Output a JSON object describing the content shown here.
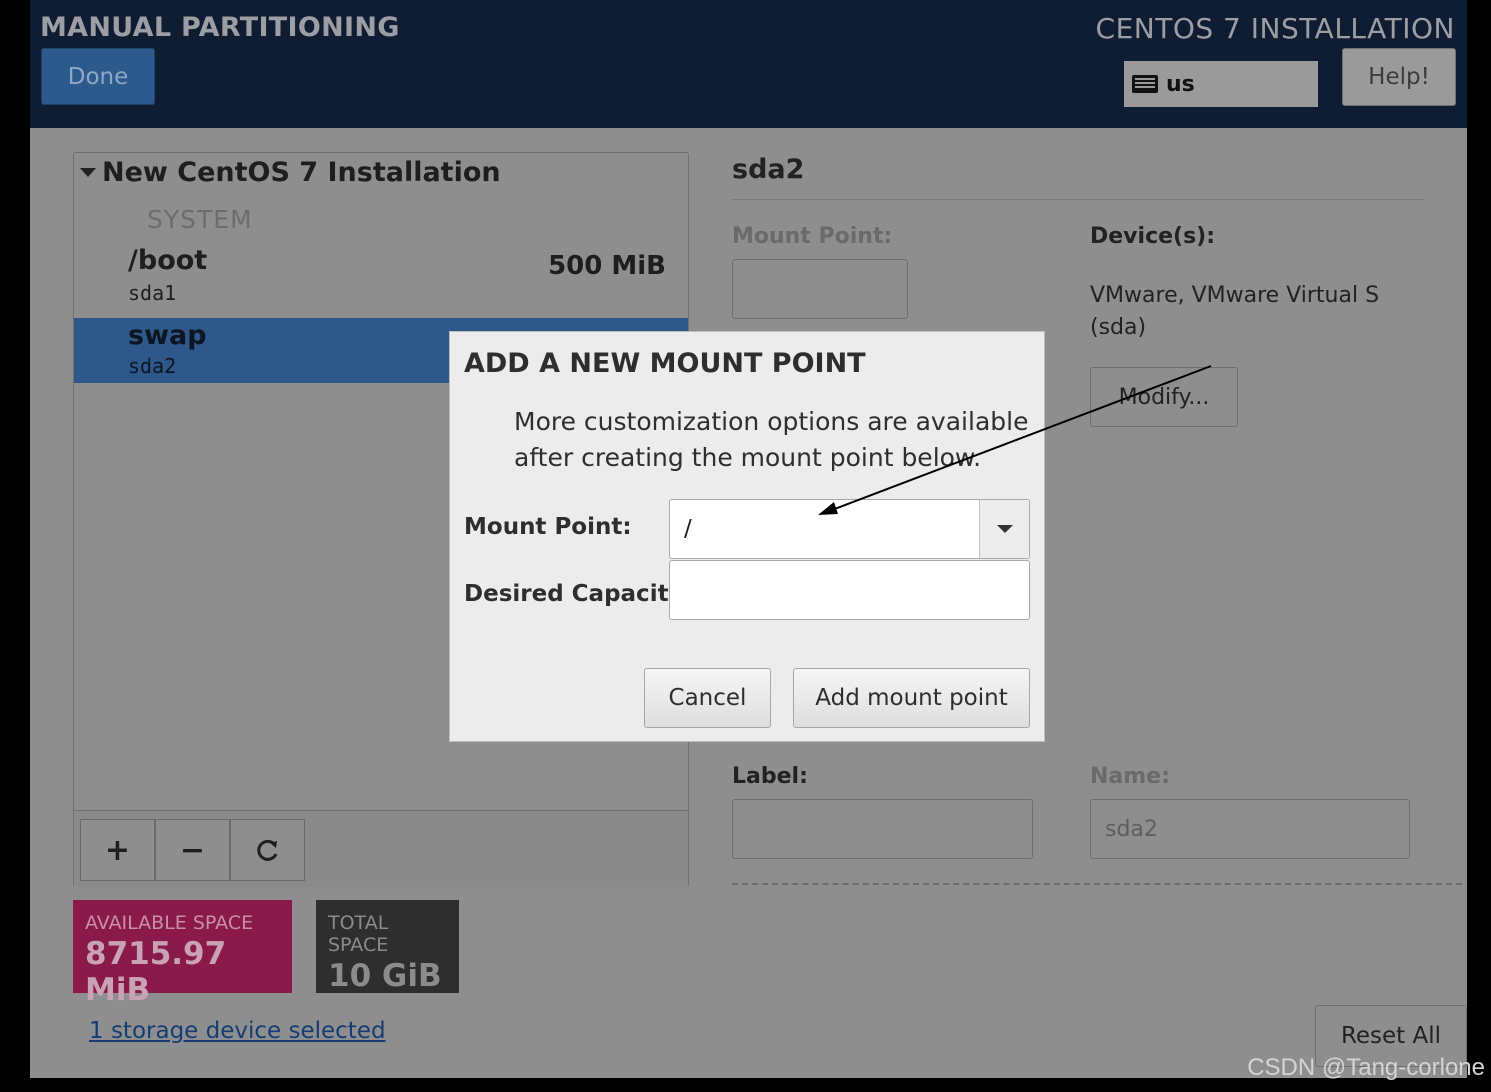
{
  "header": {
    "title": "MANUAL PARTITIONING",
    "product": "CENTOS 7 INSTALLATION",
    "done_label": "Done",
    "keyboard_layout": "us",
    "help_label": "Help!"
  },
  "left_panel": {
    "group_title": "New CentOS 7 Installation",
    "system_label": "SYSTEM",
    "mounts": [
      {
        "name": "/boot",
        "device": "sda1",
        "size": "500 MiB",
        "selected": false
      },
      {
        "name": "swap",
        "device": "sda2",
        "size": "",
        "selected": true
      }
    ],
    "toolbar": {
      "add": "+",
      "remove": "−",
      "refresh": "⟳"
    }
  },
  "space": {
    "available_label": "AVAILABLE SPACE",
    "available_value": "8715.97 MiB",
    "total_label": "TOTAL SPACE",
    "total_value": "10 GiB"
  },
  "storage_link": "1 storage device selected",
  "right_panel": {
    "title": "sda2",
    "mount_point_label": "Mount Point:",
    "devices_label": "Device(s):",
    "devices_text": "VMware, VMware Virtual S (sda)",
    "modify_label": "Modify...",
    "label_label": "Label:",
    "name_label": "Name:",
    "name_value": "sda2",
    "reset_label": "Reset All"
  },
  "dialog": {
    "title": "ADD A NEW MOUNT POINT",
    "description_line1": "More customization options are available",
    "description_line2": "after creating the mount point below.",
    "mount_point_label": "Mount Point:",
    "mount_point_value": "/",
    "capacity_label": "Desired Capacity:",
    "capacity_value": "",
    "cancel_label": "Cancel",
    "add_label": "Add mount point"
  },
  "watermark": "CSDN @Tang-corlone",
  "colors": {
    "header_bg": "#0f1d33",
    "selected_row": "#2d5889",
    "available_space": "#8a1a4a",
    "total_space": "#2e2e2e",
    "dialog_bg": "#ececec"
  }
}
